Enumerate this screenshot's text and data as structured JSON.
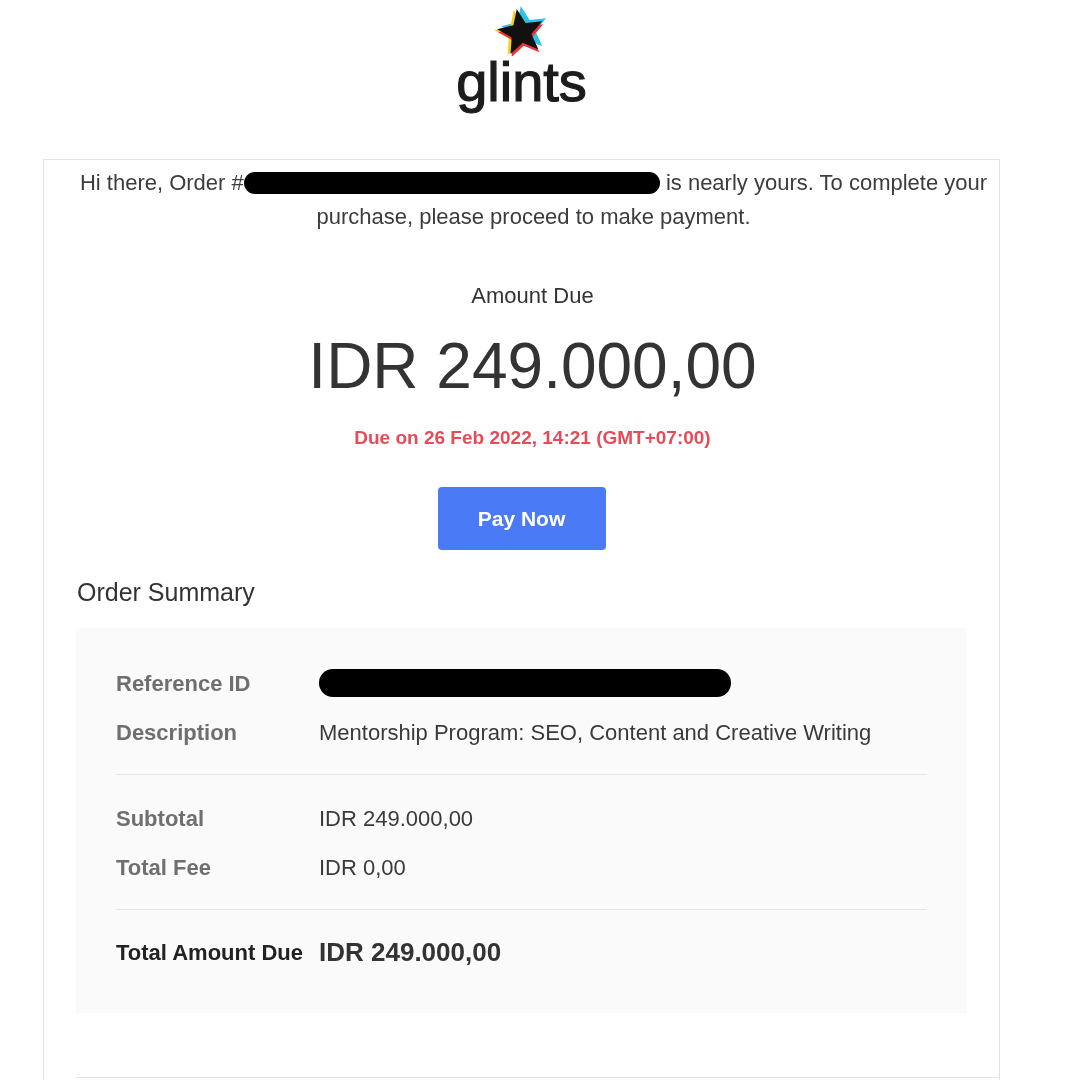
{
  "logo": {
    "wordmark": "glints"
  },
  "intro": {
    "before": "Hi there, Order #",
    "order_number_redacted": true,
    "after": "is nearly yours. To complete your purchase, please proceed to make payment."
  },
  "amount": {
    "label": "Amount Due",
    "value": "IDR 249.000,00",
    "due": "Due on 26 Feb 2022, 14:21 (GMT+07:00)"
  },
  "pay_button": {
    "label": "Pay Now"
  },
  "order_summary": {
    "title": "Order Summary",
    "sections": [
      {
        "rows": [
          {
            "kind": "item",
            "label": "Reference ID",
            "redacted": true
          },
          {
            "kind": "item",
            "label": "Description",
            "value": "Mentorship Program: SEO, Content and Creative Writing",
            "redacted": false
          }
        ]
      },
      {
        "rows": [
          {
            "kind": "item",
            "label": "Subtotal",
            "value": "IDR 249.000,00",
            "redacted": false
          },
          {
            "kind": "item",
            "label": "Total Fee",
            "value": "IDR 0,00",
            "redacted": false
          }
        ]
      },
      {
        "rows": [
          {
            "kind": "total",
            "label": "Total Amount Due",
            "value": "IDR 249.000,00",
            "redacted": false
          }
        ]
      }
    ]
  }
}
